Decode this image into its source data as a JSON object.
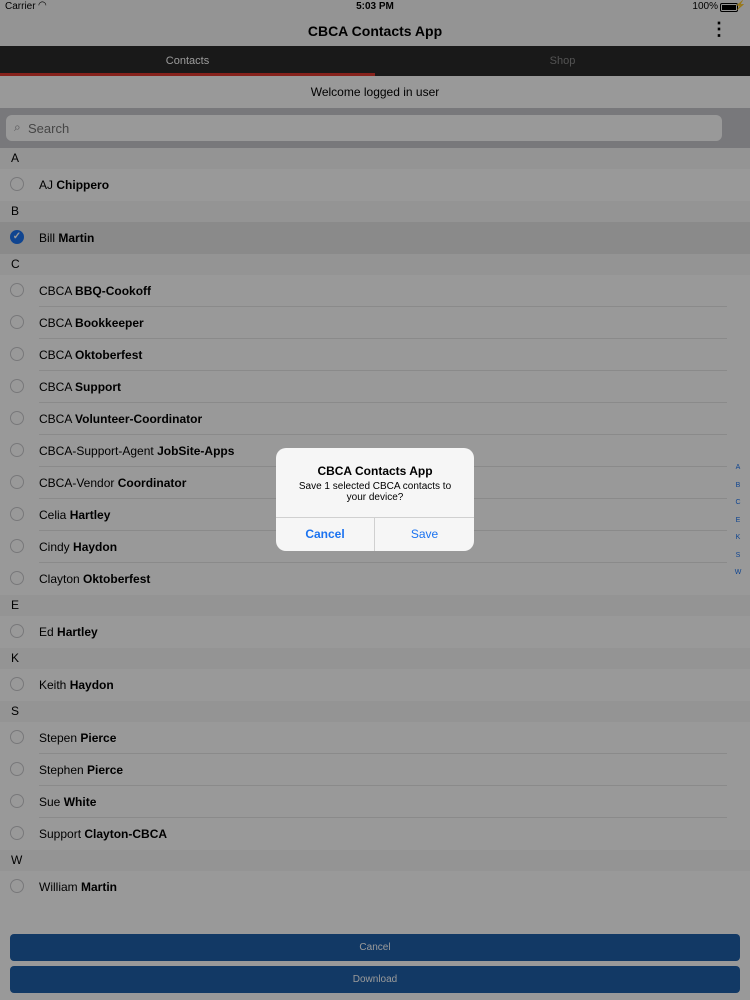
{
  "status_bar": {
    "carrier": "Carrier",
    "time": "5:03 PM",
    "battery": "100%"
  },
  "nav_bar": {
    "title": "CBCA Contacts App"
  },
  "tabs": [
    {
      "label": "Contacts",
      "selected": true
    },
    {
      "label": "Shop",
      "selected": false
    }
  ],
  "welcome": "Welcome logged in user",
  "search": {
    "placeholder": "Search"
  },
  "sections": [
    {
      "letter": "A",
      "contacts": [
        {
          "first": "AJ",
          "last": "Chippero",
          "checked": false
        }
      ]
    },
    {
      "letter": "B",
      "contacts": [
        {
          "first": "Bill",
          "last": "Martin",
          "checked": true
        }
      ]
    },
    {
      "letter": "C",
      "contacts": [
        {
          "first": "CBCA",
          "last": "BBQ-Cookoff",
          "checked": false
        },
        {
          "first": "CBCA",
          "last": "Bookkeeper",
          "checked": false
        },
        {
          "first": "CBCA",
          "last": "Oktoberfest",
          "checked": false
        },
        {
          "first": "CBCA",
          "last": "Support",
          "checked": false
        },
        {
          "first": "CBCA",
          "last": "Volunteer-Coordinator",
          "checked": false
        },
        {
          "first": "CBCA-Support-Agent",
          "last": "JobSite-Apps",
          "checked": false
        },
        {
          "first": "CBCA-Vendor",
          "last": "Coordinator",
          "checked": false
        },
        {
          "first": "Celia",
          "last": "Hartley",
          "checked": false
        },
        {
          "first": "Cindy",
          "last": "Haydon",
          "checked": false
        },
        {
          "first": "Clayton",
          "last": "Oktoberfest",
          "checked": false
        }
      ]
    },
    {
      "letter": "E",
      "contacts": [
        {
          "first": "Ed",
          "last": "Hartley",
          "checked": false
        }
      ]
    },
    {
      "letter": "K",
      "contacts": [
        {
          "first": "Keith",
          "last": "Haydon",
          "checked": false
        }
      ]
    },
    {
      "letter": "S",
      "contacts": [
        {
          "first": "Stepen ",
          "last": "Pierce",
          "checked": false
        },
        {
          "first": "Stephen ",
          "last": "Pierce",
          "checked": false
        },
        {
          "first": "Sue",
          "last": "White",
          "checked": false
        },
        {
          "first": "Support",
          "last": "Clayton-CBCA",
          "checked": false
        }
      ]
    },
    {
      "letter": "W",
      "contacts": [
        {
          "first": "William",
          "last": "Martin",
          "checked": false
        }
      ]
    }
  ],
  "section_index": [
    "A",
    "B",
    "C",
    "E",
    "K",
    "S",
    "W"
  ],
  "alert": {
    "title": "CBCA Contacts App",
    "message": "Save 1 selected CBCA contacts to your device?",
    "cancel_label": "Cancel",
    "save_label": "Save"
  },
  "bottom_buttons": {
    "cancel_label": "Cancel",
    "download_label": "Download"
  },
  "colors": {
    "accent": "#1b73f0",
    "tab_indicator": "#e23a30",
    "button": "#1e5fa8"
  },
  "icons": {
    "wifi": "wifi-icon",
    "more": "more-vertical-icon",
    "search": "search-icon",
    "checkmark": "checkmark-icon"
  }
}
